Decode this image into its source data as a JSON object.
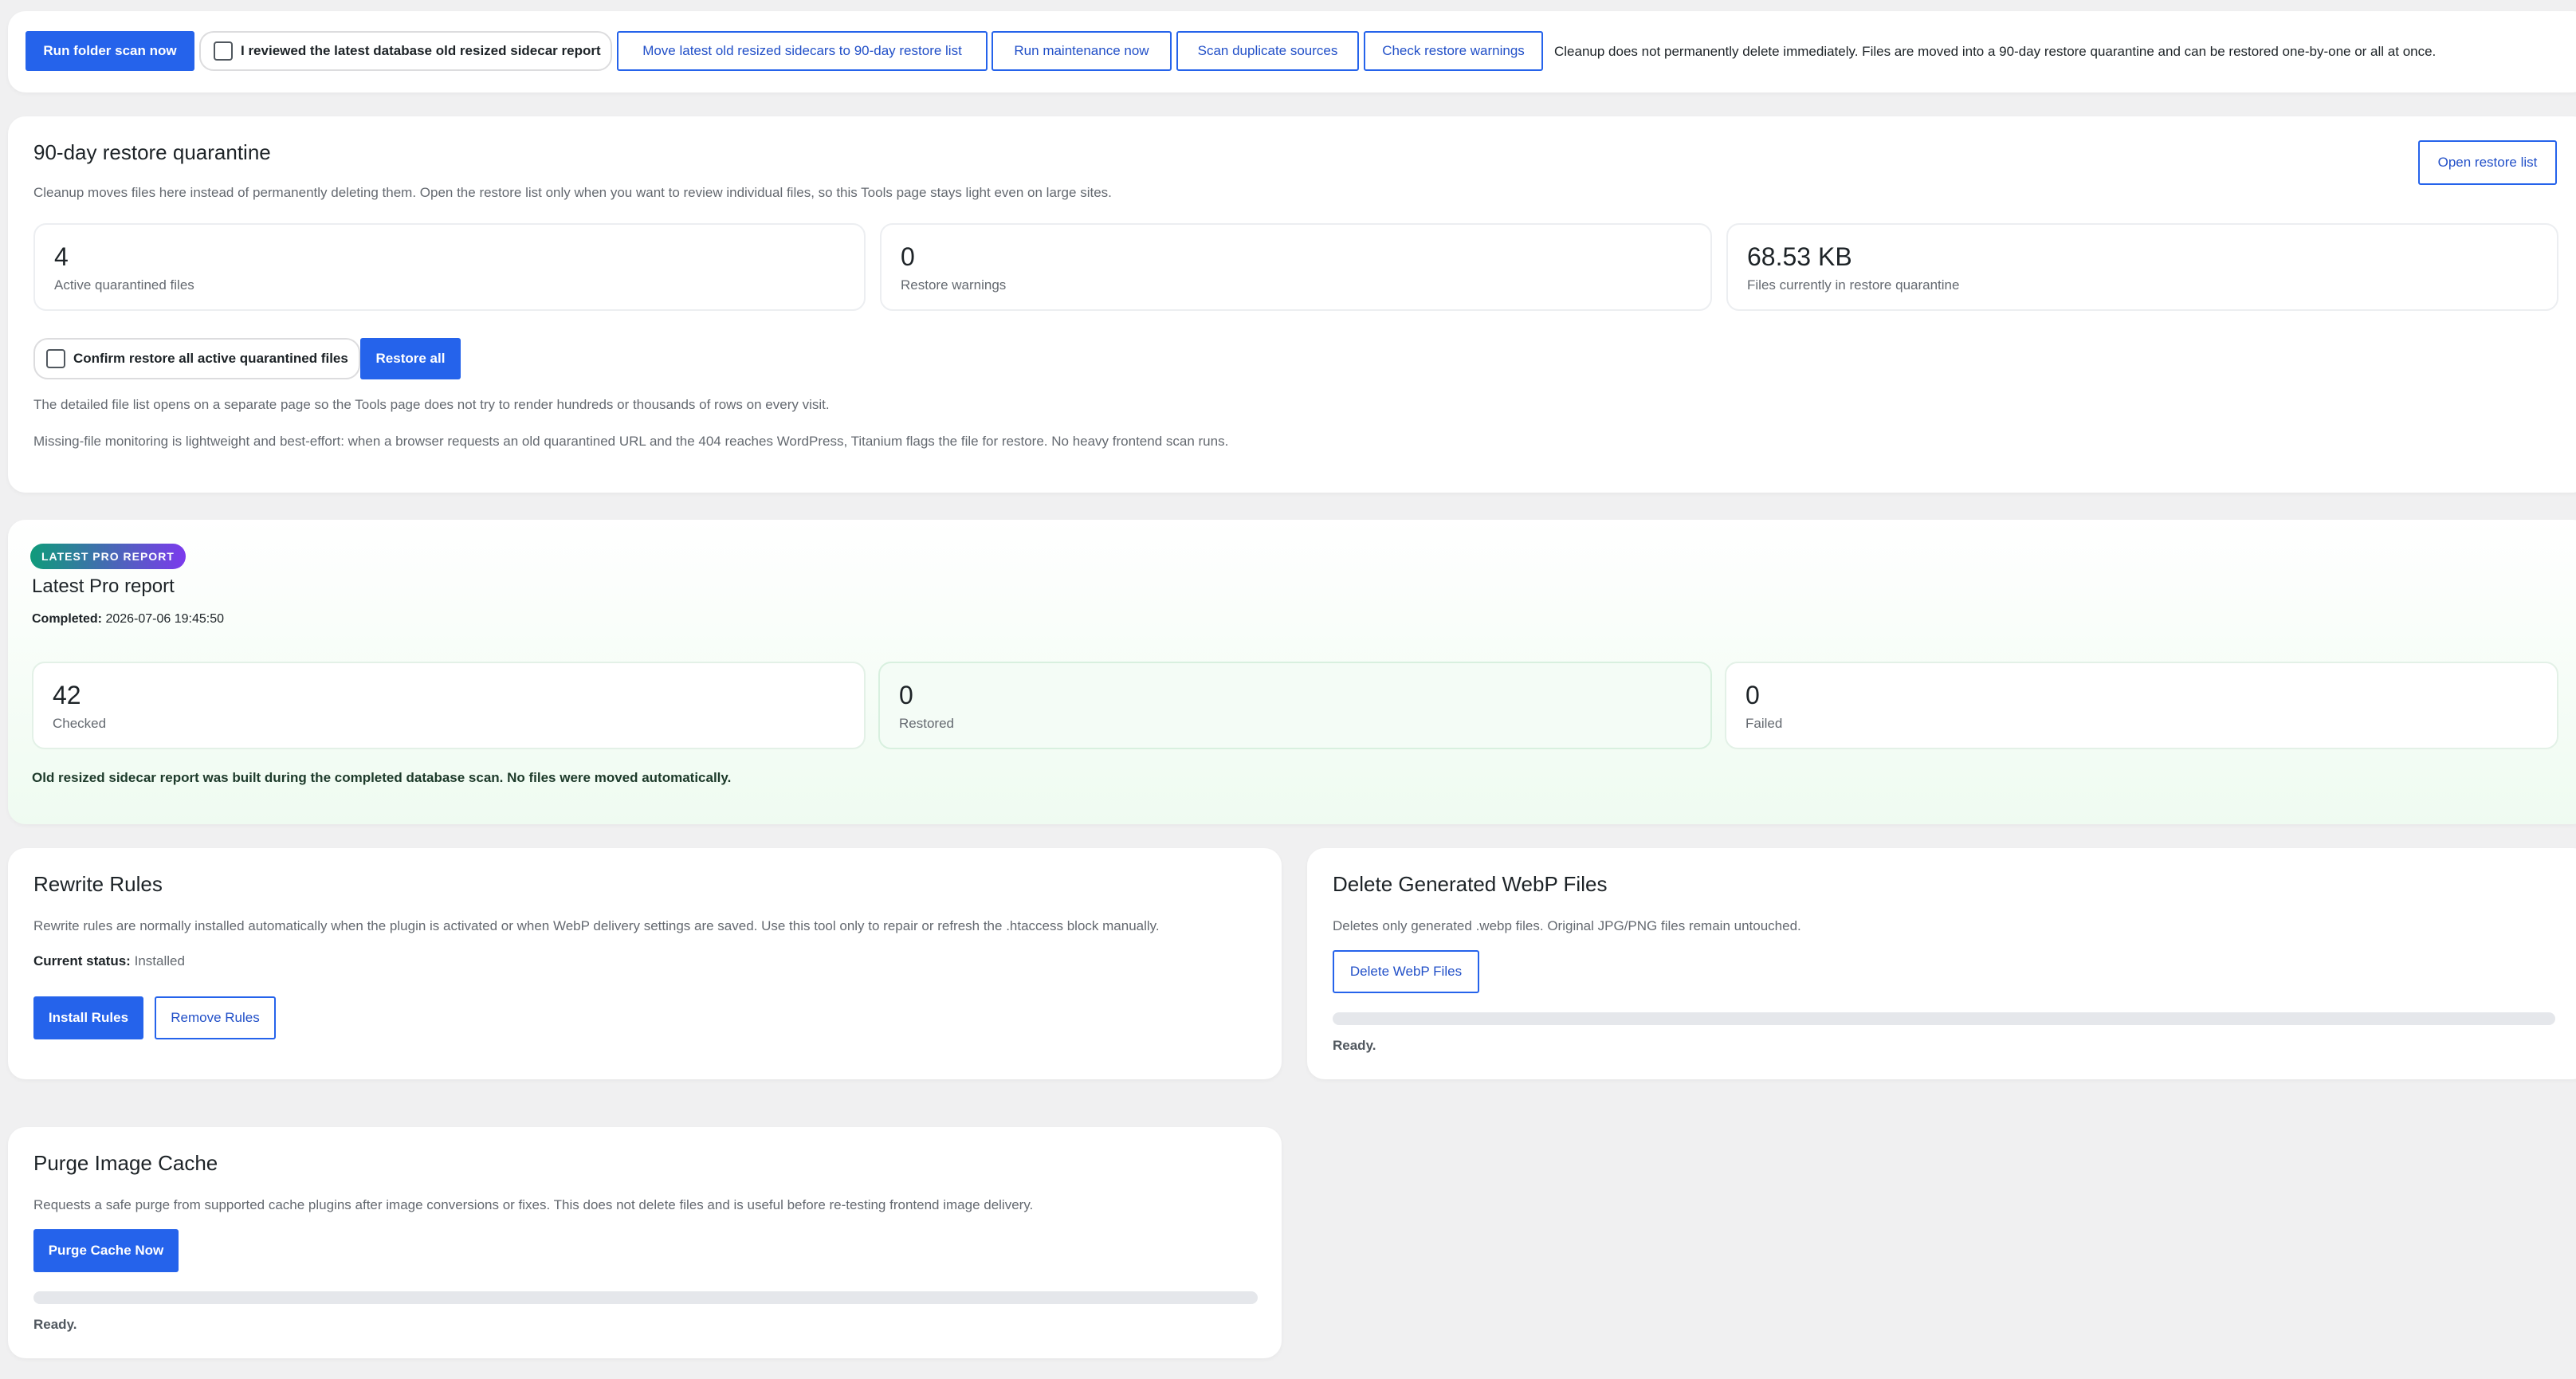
{
  "toolbar": {
    "run_scan": "Run folder scan now",
    "reviewed_label": "I reviewed the latest database old resized sidecar report",
    "move_sidecars": "Move latest old resized sidecars to 90-day restore list",
    "run_maintenance": "Run maintenance now",
    "scan_duplicates": "Scan duplicate sources",
    "check_warnings": "Check restore warnings",
    "note": "Cleanup does not permanently delete immediately. Files are moved into a 90-day restore quarantine and can be restored one-by-one or all at once."
  },
  "quarantine": {
    "title": "90-day restore quarantine",
    "open_restore_list": "Open restore list",
    "description": "Cleanup moves files here instead of permanently deleting them. Open the restore list only when you want to review individual files, so this Tools page stays light even on large sites.",
    "stats": [
      {
        "value": "4",
        "label": "Active quarantined files"
      },
      {
        "value": "0",
        "label": "Restore warnings"
      },
      {
        "value": "68.53 KB",
        "label": "Files currently in restore quarantine"
      }
    ],
    "confirm_label": "Confirm restore all active quarantined files",
    "restore_all": "Restore all",
    "note1": "The detailed file list opens on a separate page so the Tools page does not try to render hundreds or thousands of rows on every visit.",
    "note2": "Missing-file monitoring is lightweight and best-effort: when a browser requests an old quarantined URL and the 404 reaches WordPress, Titanium flags the file for restore. No heavy frontend scan runs."
  },
  "pro_report": {
    "badge": "LATEST PRO REPORT",
    "title": "Latest Pro report",
    "completed_label": "Completed:",
    "completed_value": "2026-07-06 19:45:50",
    "stats": [
      {
        "value": "42",
        "label": "Checked"
      },
      {
        "value": "0",
        "label": "Restored"
      },
      {
        "value": "0",
        "label": "Failed"
      }
    ],
    "note": "Old resized sidecar report was built during the completed database scan. No files were moved automatically."
  },
  "rewrite": {
    "title": "Rewrite Rules",
    "description": "Rewrite rules are normally installed automatically when the plugin is activated or when WebP delivery settings are saved. Use this tool only to repair or refresh the .htaccess block manually.",
    "status_label": "Current status:",
    "status_value": "Installed",
    "install": "Install Rules",
    "remove": "Remove Rules"
  },
  "webp": {
    "title": "Delete Generated WebP Files",
    "description": "Deletes only generated .webp files. Original JPG/PNG files remain untouched.",
    "button": "Delete WebP Files",
    "progress": 0,
    "status": "Ready."
  },
  "purge": {
    "title": "Purge Image Cache",
    "description": "Requests a safe purge from supported cache plugins after image conversions or fixes. This does not delete files and is useful before re-testing frontend image delivery.",
    "button": "Purge Cache Now",
    "progress": 0,
    "status": "Ready."
  },
  "colors": {
    "primary": "#2563eb",
    "badge_gradient_start": "#0f9b7a",
    "badge_gradient_end": "#7c3aed",
    "pro_background": "#f3fcf5"
  }
}
